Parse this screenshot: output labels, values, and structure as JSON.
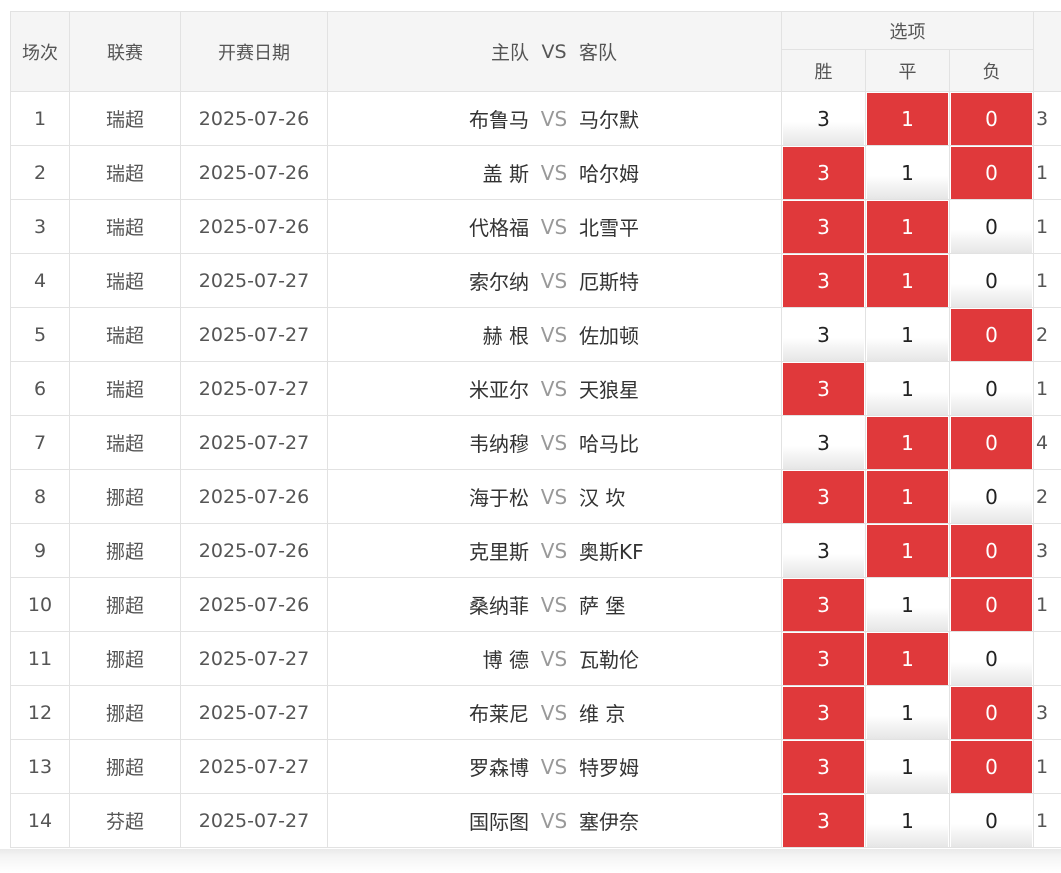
{
  "header": {
    "no": "场次",
    "league": "联赛",
    "date": "开赛日期",
    "home": "主队",
    "vs": "VS",
    "away": "客队",
    "options": "选项",
    "win": "胜",
    "draw": "平",
    "lose": "负"
  },
  "option_values": {
    "win": "3",
    "draw": "1",
    "lose": "0"
  },
  "colors": {
    "selected": "#e0393b",
    "header_bg": "#f5f5f5",
    "border": "#e2e2e2"
  },
  "rows": [
    {
      "no": "1",
      "league": "瑞超",
      "date": "2025-07-26",
      "home": "布鲁马",
      "away": "马尔默",
      "win": false,
      "draw": true,
      "lose": true,
      "extra": "3"
    },
    {
      "no": "2",
      "league": "瑞超",
      "date": "2025-07-26",
      "home": "盖 斯",
      "away": "哈尔姆",
      "win": true,
      "draw": false,
      "lose": true,
      "extra": "1"
    },
    {
      "no": "3",
      "league": "瑞超",
      "date": "2025-07-26",
      "home": "代格福",
      "away": "北雪平",
      "win": true,
      "draw": true,
      "lose": false,
      "extra": "1"
    },
    {
      "no": "4",
      "league": "瑞超",
      "date": "2025-07-27",
      "home": "索尔纳",
      "away": "厄斯特",
      "win": true,
      "draw": true,
      "lose": false,
      "extra": "1"
    },
    {
      "no": "5",
      "league": "瑞超",
      "date": "2025-07-27",
      "home": "赫 根",
      "away": "佐加顿",
      "win": false,
      "draw": false,
      "lose": true,
      "extra": "2"
    },
    {
      "no": "6",
      "league": "瑞超",
      "date": "2025-07-27",
      "home": "米亚尔",
      "away": "天狼星",
      "win": true,
      "draw": false,
      "lose": false,
      "extra": "1"
    },
    {
      "no": "7",
      "league": "瑞超",
      "date": "2025-07-27",
      "home": "韦纳穆",
      "away": "哈马比",
      "win": false,
      "draw": true,
      "lose": true,
      "extra": "4"
    },
    {
      "no": "8",
      "league": "挪超",
      "date": "2025-07-26",
      "home": "海于松",
      "away": "汉 坎",
      "win": true,
      "draw": true,
      "lose": false,
      "extra": "2"
    },
    {
      "no": "9",
      "league": "挪超",
      "date": "2025-07-26",
      "home": "克里斯",
      "away": "奥斯KF",
      "win": false,
      "draw": true,
      "lose": true,
      "extra": "3"
    },
    {
      "no": "10",
      "league": "挪超",
      "date": "2025-07-26",
      "home": "桑纳菲",
      "away": "萨 堡",
      "win": true,
      "draw": false,
      "lose": true,
      "extra": "1"
    },
    {
      "no": "11",
      "league": "挪超",
      "date": "2025-07-27",
      "home": "博 德",
      "away": "瓦勒伦",
      "win": true,
      "draw": true,
      "lose": false,
      "extra": ""
    },
    {
      "no": "12",
      "league": "挪超",
      "date": "2025-07-27",
      "home": "布莱尼",
      "away": "维 京",
      "win": true,
      "draw": false,
      "lose": true,
      "extra": "3"
    },
    {
      "no": "13",
      "league": "挪超",
      "date": "2025-07-27",
      "home": "罗森博",
      "away": "特罗姆",
      "win": true,
      "draw": false,
      "lose": true,
      "extra": "1"
    },
    {
      "no": "14",
      "league": "芬超",
      "date": "2025-07-27",
      "home": "国际图",
      "away": "塞伊奈",
      "win": true,
      "draw": false,
      "lose": false,
      "extra": "1"
    }
  ]
}
